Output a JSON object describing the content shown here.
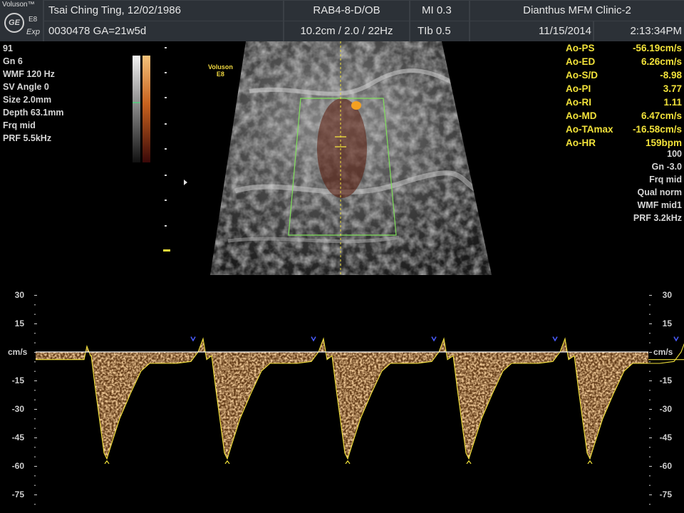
{
  "header": {
    "brand": "Voluson™",
    "logo_text": "GE",
    "model_short": "E8",
    "exp": "Exp",
    "patient": "Tsai Ching Ting,  12/02/1986",
    "patient_id_ga": "0030478  GA=21w5d",
    "probe": "RAB4-8-D/OB",
    "depth_zoom_freq": "10.2cm / 2.0 / 22Hz",
    "mi": "MI  0.3",
    "tib": "TIb  0.5",
    "clinic": "Dianthus MFM Clinic-2",
    "date": "11/15/2014",
    "time": "2:13:34PM"
  },
  "left_params": [
    "91",
    "Gn  6",
    "WMF 120 Hz",
    "SV Angle  0",
    "Size  2.0mm",
    "Depth 63.1mm",
    "Frq mid",
    "PRF  5.5kHz"
  ],
  "image_label": {
    "line1": "Voluson",
    "line2": "E8"
  },
  "measurements": [
    {
      "k": "Ao-PS",
      "v": "-56.19cm/s"
    },
    {
      "k": "Ao-ED",
      "v": "6.26cm/s"
    },
    {
      "k": "Ao-S/D",
      "v": "-8.98"
    },
    {
      "k": "Ao-PI",
      "v": "3.77"
    },
    {
      "k": "Ao-RI",
      "v": "1.11"
    },
    {
      "k": "Ao-MD",
      "v": "6.47cm/s"
    },
    {
      "k": "Ao-TAmax",
      "v": "-16.58cm/s"
    },
    {
      "k": "Ao-HR",
      "v": "159bpm"
    }
  ],
  "right_params": [
    "100",
    "Gn -3.0",
    "Frq mid",
    "Qual norm",
    "WMF mid1",
    "PRF  3.2kHz"
  ],
  "doppler_scale": {
    "unit": "cm/s",
    "ticks": [
      {
        "v": 30,
        "label": "30"
      },
      {
        "v": 15,
        "label": "15"
      },
      {
        "v": -15,
        "label": "-15"
      },
      {
        "v": -30,
        "label": "-30"
      },
      {
        "v": -45,
        "label": "-45"
      },
      {
        "v": -60,
        "label": "-60"
      },
      {
        "v": -75,
        "label": "-75"
      }
    ]
  },
  "colors": {
    "measure_text": "#f2e23a",
    "roi_box": "#7fe05a",
    "spectrum": "#e9a55a",
    "trace": "#f2e23a"
  }
}
